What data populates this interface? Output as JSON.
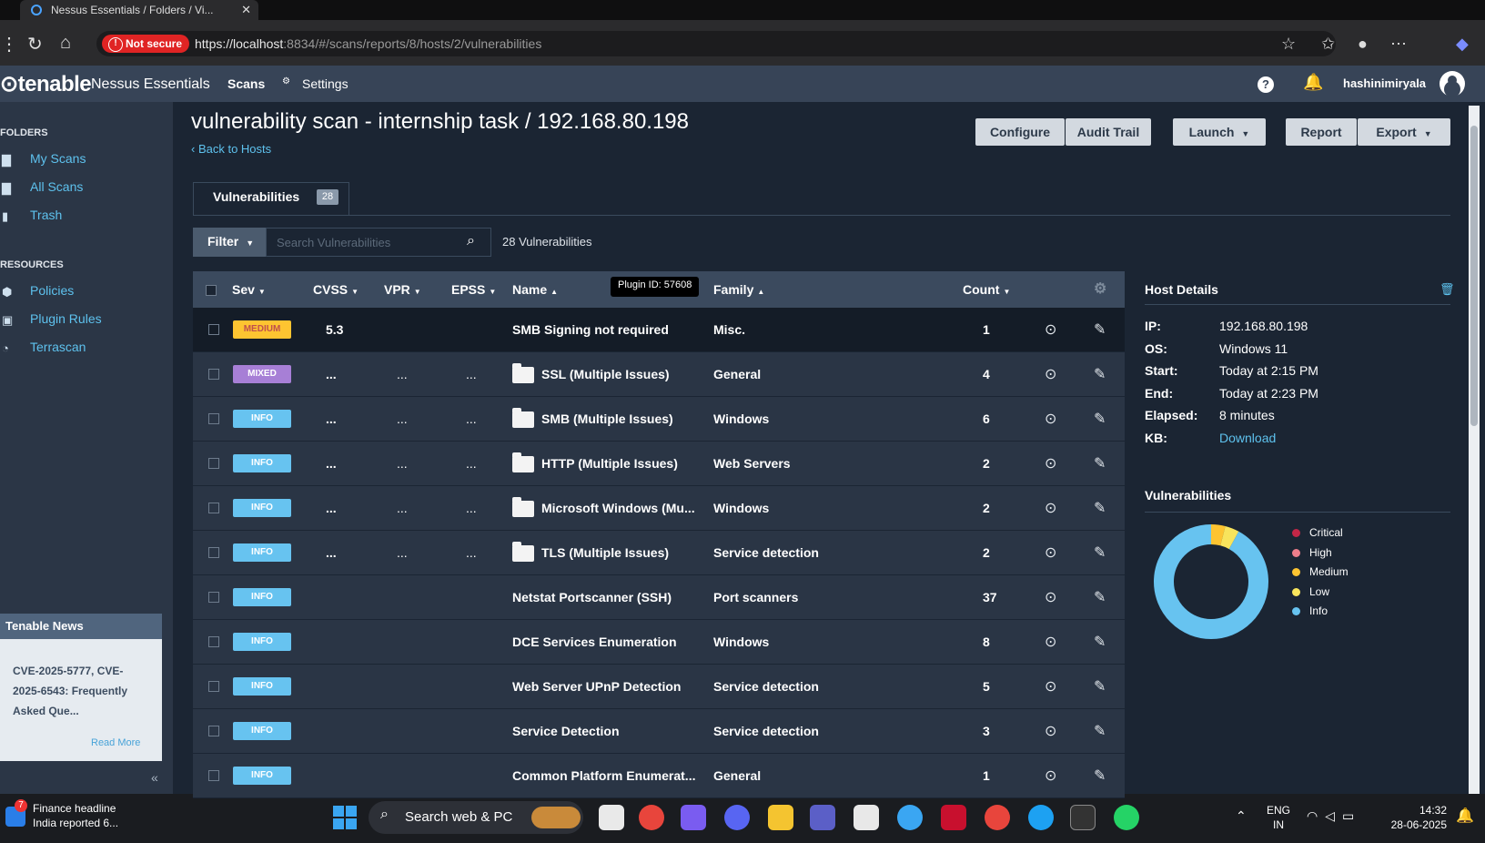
{
  "browser": {
    "tab_title": "Nessus Essentials / Folders / Vi...",
    "not_secure": "Not secure",
    "url_host": "https://localhost",
    "url_path": ":8834/#/scans/reports/8/hosts/2/vulnerabilities"
  },
  "app": {
    "brand": "tenable",
    "product": "Nessus Essentials",
    "nav": {
      "scans": "Scans",
      "settings": "Settings"
    },
    "user": "hashinimiryala"
  },
  "sidebar": {
    "folders_label": "FOLDERS",
    "folders": [
      {
        "label": "My Scans",
        "icon": "folder-icon"
      },
      {
        "label": "All Scans",
        "icon": "folder-icon"
      },
      {
        "label": "Trash",
        "icon": "trash-icon"
      }
    ],
    "resources_label": "RESOURCES",
    "resources": [
      {
        "label": "Policies",
        "icon": "policy-icon"
      },
      {
        "label": "Plugin Rules",
        "icon": "plugin-rules-icon"
      },
      {
        "label": "Terrascan",
        "icon": "terrascan-icon"
      }
    ],
    "news": {
      "title": "Tenable News",
      "body": "CVE-2025-5777, CVE-2025-6543: Frequently Asked Que...",
      "read_more": "Read More"
    }
  },
  "page": {
    "title": "vulnerability scan - internship task / 192.168.80.198",
    "back": "Back to Hosts",
    "buttons": {
      "configure": "Configure",
      "audit_trail": "Audit Trail",
      "launch": "Launch",
      "report": "Report",
      "export": "Export"
    },
    "tab_label": "Vulnerabilities",
    "tab_count": "28",
    "filter": "Filter",
    "search_placeholder": "Search Vulnerabilities",
    "vuln_count_text": "28 Vulnerabilities"
  },
  "table": {
    "headers": {
      "sev": "Sev",
      "cvss": "CVSS",
      "vpr": "VPR",
      "epss": "EPSS",
      "name": "Name",
      "family": "Family",
      "count": "Count"
    },
    "tooltip": "Plugin ID: 57608",
    "rows": [
      {
        "sev": "MEDIUM",
        "sev_color": "#fdc431",
        "cvss": "5.3",
        "vpr": "",
        "epss": "",
        "name": "SMB Signing not required",
        "folder": false,
        "family": "Misc.",
        "count": "1"
      },
      {
        "sev": "MIXED",
        "sev_color": "#a77fd6",
        "cvss": "...",
        "vpr": "...",
        "epss": "...",
        "name": "SSL (Multiple Issues)",
        "folder": true,
        "family": "General",
        "count": "4"
      },
      {
        "sev": "INFO",
        "sev_color": "#67c3f0",
        "cvss": "...",
        "vpr": "...",
        "epss": "...",
        "name": "SMB (Multiple Issues)",
        "folder": true,
        "family": "Windows",
        "count": "6"
      },
      {
        "sev": "INFO",
        "sev_color": "#67c3f0",
        "cvss": "...",
        "vpr": "...",
        "epss": "...",
        "name": "HTTP (Multiple Issues)",
        "folder": true,
        "family": "Web Servers",
        "count": "2"
      },
      {
        "sev": "INFO",
        "sev_color": "#67c3f0",
        "cvss": "...",
        "vpr": "...",
        "epss": "...",
        "name": "Microsoft Windows (Mu...",
        "folder": true,
        "family": "Windows",
        "count": "2"
      },
      {
        "sev": "INFO",
        "sev_color": "#67c3f0",
        "cvss": "...",
        "vpr": "...",
        "epss": "...",
        "name": "TLS (Multiple Issues)",
        "folder": true,
        "family": "Service detection",
        "count": "2"
      },
      {
        "sev": "INFO",
        "sev_color": "#67c3f0",
        "cvss": "",
        "vpr": "",
        "epss": "",
        "name": "Netstat Portscanner (SSH)",
        "folder": false,
        "family": "Port scanners",
        "count": "37"
      },
      {
        "sev": "INFO",
        "sev_color": "#67c3f0",
        "cvss": "",
        "vpr": "",
        "epss": "",
        "name": "DCE Services Enumeration",
        "folder": false,
        "family": "Windows",
        "count": "8"
      },
      {
        "sev": "INFO",
        "sev_color": "#67c3f0",
        "cvss": "",
        "vpr": "",
        "epss": "",
        "name": "Web Server UPnP Detection",
        "folder": false,
        "family": "Service detection",
        "count": "5"
      },
      {
        "sev": "INFO",
        "sev_color": "#67c3f0",
        "cvss": "",
        "vpr": "",
        "epss": "",
        "name": "Service Detection",
        "folder": false,
        "family": "Service detection",
        "count": "3"
      },
      {
        "sev": "INFO",
        "sev_color": "#67c3f0",
        "cvss": "",
        "vpr": "",
        "epss": "",
        "name": "Common Platform Enumerat...",
        "folder": false,
        "family": "General",
        "count": "1"
      }
    ]
  },
  "host_details": {
    "title": "Host Details",
    "fields": [
      {
        "key": "IP:",
        "value": "192.168.80.198"
      },
      {
        "key": "OS:",
        "value": "Windows 11"
      },
      {
        "key": "Start:",
        "value": "Today at 2:15 PM"
      },
      {
        "key": "End:",
        "value": "Today at 2:23 PM"
      },
      {
        "key": "Elapsed:",
        "value": "8 minutes"
      },
      {
        "key": "KB:",
        "value": "Download"
      }
    ],
    "vuln_title": "Vulnerabilities",
    "legend": [
      {
        "label": "Critical",
        "color": "#c32747"
      },
      {
        "label": "High",
        "color": "#ee7e8b"
      },
      {
        "label": "Medium",
        "color": "#fdc431"
      },
      {
        "label": "Low",
        "color": "#f8e45c"
      },
      {
        "label": "Info",
        "color": "#67c3f0"
      }
    ],
    "donut_shares": {
      "critical": 0,
      "high": 0,
      "medium": 0.04,
      "low": 0.04,
      "info": 0.92
    }
  },
  "taskbar": {
    "news_badge": "7",
    "news_line1": "Finance headline",
    "news_line2": "India reported 6...",
    "search": "Search web & PC",
    "lang1": "ENG",
    "lang2": "IN",
    "time": "14:32",
    "date": "28-06-2025"
  },
  "colors": {
    "accent_link": "#5ec2ee",
    "page_bg": "#1b2533",
    "header_bg": "#374457"
  }
}
